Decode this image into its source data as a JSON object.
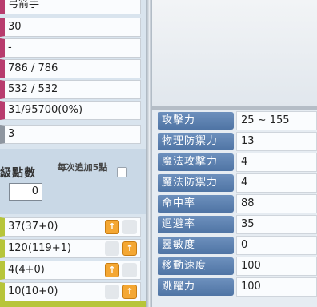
{
  "character_info": {
    "job": "弓箭手",
    "level": "30",
    "guild": "-",
    "hp": "786 / 786",
    "mp": "532 / 532",
    "exp": "31/95700(0%)",
    "fame": "3"
  },
  "ability_points": {
    "label": "級點數",
    "value": "0",
    "add5_label": "每次追加5點",
    "add5_checked": false
  },
  "stats": [
    {
      "value": "37(37+0)",
      "up_enabled": true
    },
    {
      "value": "120(119+1)",
      "up_enabled": true
    },
    {
      "value": "4(4+0)",
      "up_enabled": true
    },
    {
      "value": "10(10+0)",
      "up_enabled": true
    }
  ],
  "attributes": [
    {
      "label": "攻擊力",
      "value": "25 ~ 155"
    },
    {
      "label": "物理防禦力",
      "value": "13"
    },
    {
      "label": "魔法攻擊力",
      "value": "4"
    },
    {
      "label": "魔法防禦力",
      "value": "4"
    },
    {
      "label": "命中率",
      "value": "88"
    },
    {
      "label": "迴避率",
      "value": "35"
    },
    {
      "label": "靈敏度",
      "value": "0"
    },
    {
      "label": "移動速度",
      "value": "100"
    },
    {
      "label": "跳躍力",
      "value": "100"
    }
  ],
  "colors": {
    "info_accent": "#b83c6e",
    "stat_accent": "#b7c53a",
    "label_blue": "#5a7eae",
    "up_button": "#f4a733"
  }
}
